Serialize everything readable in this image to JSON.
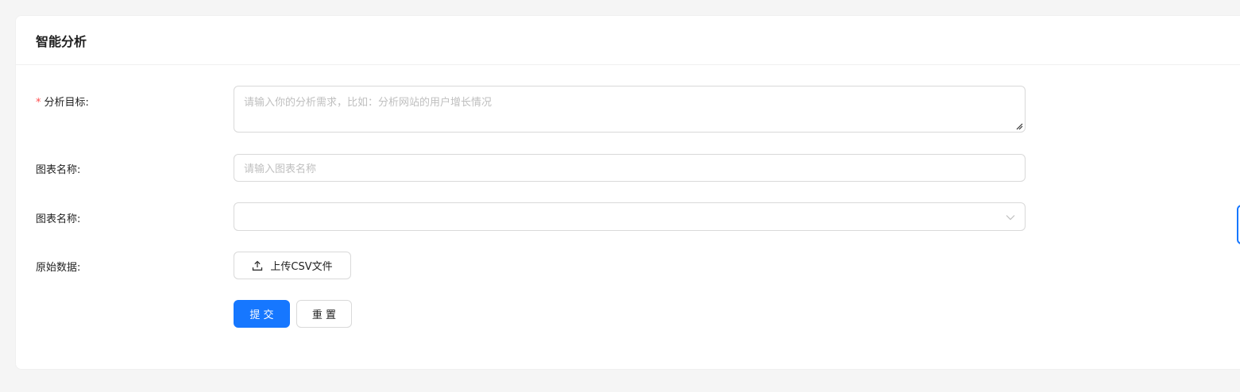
{
  "card": {
    "title": "智能分析"
  },
  "form": {
    "goal": {
      "required_mark": "*",
      "label": "分析目标:",
      "placeholder": "请输入你的分析需求，比如：分析网站的用户增长情况"
    },
    "chart_name": {
      "label": "图表名称:",
      "placeholder": "请输入图表名称"
    },
    "chart_type": {
      "label": "图表名称:",
      "value": ""
    },
    "raw_data": {
      "label": "原始数据:",
      "upload_label": "上传CSV文件"
    },
    "submit_label": "提 交",
    "reset_label": "重 置"
  },
  "colors": {
    "primary": "#1677ff",
    "required": "#ff4d4f",
    "border": "#d9d9d9",
    "placeholder": "#bfbfbf",
    "background": "#f5f5f5"
  },
  "icons": {
    "upload": "upload-icon",
    "select_arrow": "chevron-down-icon",
    "resize": "resize-handle-icon"
  }
}
